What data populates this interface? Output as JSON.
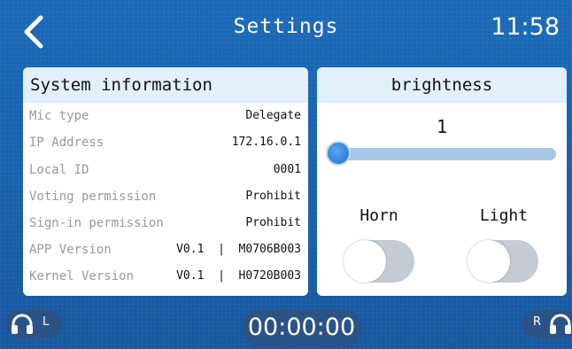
{
  "header": {
    "title": "Settings",
    "time": "11:58"
  },
  "system_info": {
    "heading": "System information",
    "rows": [
      {
        "label": "Mic type",
        "value": "Delegate"
      },
      {
        "label": "IP Address",
        "value": "172.16.0.1"
      },
      {
        "label": "Local ID",
        "value": "0001"
      },
      {
        "label": "Voting permission",
        "value": "Prohibit"
      },
      {
        "label": "Sign-in permission",
        "value": "Prohibit"
      },
      {
        "label": "APP Version",
        "value": "V0.1  |  M0706B003"
      },
      {
        "label": "Kernel Version",
        "value": "V0.1  |  H0720B003"
      }
    ]
  },
  "brightness": {
    "heading": "brightness",
    "value": "1",
    "slider_fraction": 0.0
  },
  "toggles": {
    "horn_label": "Horn",
    "horn_on": false,
    "light_label": "Light",
    "light_on": false
  },
  "footer": {
    "timer": "00:00:00",
    "left_side": "L",
    "right_side": "R"
  },
  "colors": {
    "background": "#1b5fa8",
    "panel_header": "#e1f0fb",
    "slider_track": "#a9c6e6",
    "slider_thumb": "#1e6fd0",
    "toggle_off": "#c4cbd2",
    "footer_pill": "#2c5386"
  },
  "icons": {
    "back": "chevron-left-icon",
    "headphones": "headphones-icon"
  }
}
